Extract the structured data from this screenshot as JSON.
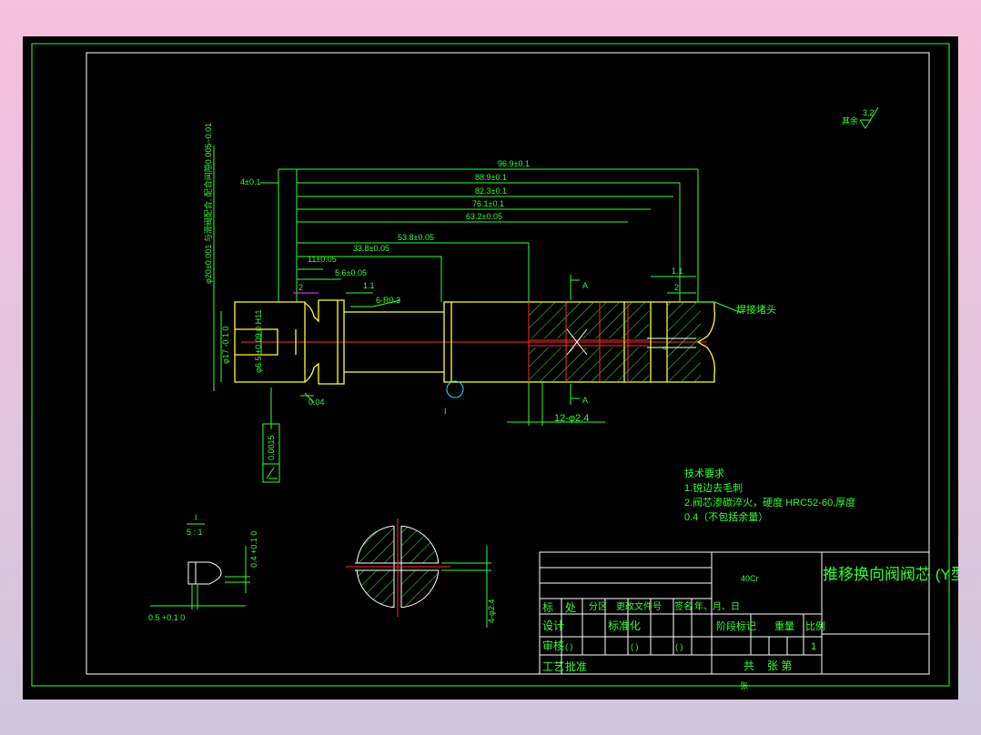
{
  "drawing": {
    "dimensions": {
      "d_96_9": "96.9±0.1",
      "d_88_9": "88.9±0.1",
      "d_82_3": "82.3±0.1",
      "d_76_1": "76.1±0.1",
      "d_63_2": "63.2±0.05",
      "d_53_8": "53.8±0.05",
      "d_33_8": "33.8±0.05",
      "d_11": "11±0.05",
      "d_5_6": "5.6±0.05",
      "d_4": "4±0.1",
      "d_2_left": "2",
      "d_1_1_left": "1.1",
      "d_1_1_right": "1.1",
      "d_2_right": "2",
      "fillet": "6-R0.3",
      "holes": "12-φ2.4",
      "dia_17": "φ17 -0.1 0",
      "dia_6_5": "φ6.5 +0.09 0 H11",
      "left_vertical": "φ20±0.001 与滑阀配合, 配合间隙0.005~0.01",
      "runout": "0.04",
      "tol_frame": "0.0015",
      "section_a_top": "A",
      "section_a_bottom": "A",
      "detail_label": "I",
      "depth_label": "4",
      "weld_note": "焊接堵头",
      "detail_scale_top": "I",
      "detail_scale_bottom": "5 : 1",
      "detail_h": "0.4 +0.1 0",
      "detail_w": "0.5 +0.1 0",
      "section_dia": "4-φ2.4",
      "roughness": "3.2",
      "roughness_note": "其余"
    },
    "tech_requirements": {
      "heading": "技术要求",
      "line1": "1.锐边去毛刺",
      "line2": "2.阀芯渗碳淬火，硬度 HRC52-60,厚度",
      "line3": "0.4（不包括余量）"
    },
    "title_block": {
      "material": "40Cr",
      "title": "推移换向阀阀芯 (Y型)",
      "row_mark": "标",
      "row_count": "处",
      "row_zone": "分区",
      "row_doc": "更改文件号",
      "row_sign": "签名",
      "row_date": "年、月、日",
      "design": "设计",
      "standardize": "标准化",
      "stage_mark": "阶段标记",
      "weight": "重量",
      "scale": "比例",
      "scale_val": "1",
      "review": "审核",
      "process": "工艺",
      "approve": "批准",
      "sheets_total": "共",
      "sheet_no": "张 第",
      "sheet_suffix": "张",
      "paren1": "( )",
      "paren2": "( )",
      "paren3": "( )"
    }
  }
}
